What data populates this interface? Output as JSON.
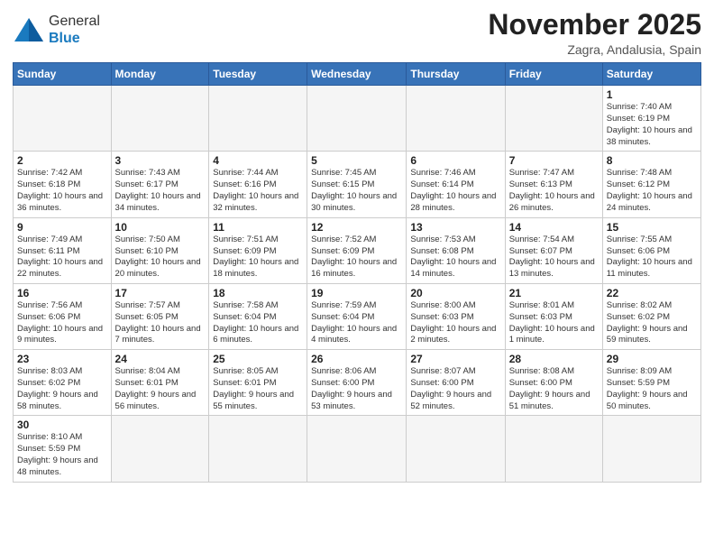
{
  "logo": {
    "text_general": "General",
    "text_blue": "Blue"
  },
  "title": "November 2025",
  "location": "Zagra, Andalusia, Spain",
  "weekdays": [
    "Sunday",
    "Monday",
    "Tuesday",
    "Wednesday",
    "Thursday",
    "Friday",
    "Saturday"
  ],
  "weeks": [
    [
      {
        "day": "",
        "info": ""
      },
      {
        "day": "",
        "info": ""
      },
      {
        "day": "",
        "info": ""
      },
      {
        "day": "",
        "info": ""
      },
      {
        "day": "",
        "info": ""
      },
      {
        "day": "",
        "info": ""
      },
      {
        "day": "1",
        "info": "Sunrise: 7:40 AM\nSunset: 6:19 PM\nDaylight: 10 hours and 38 minutes."
      }
    ],
    [
      {
        "day": "2",
        "info": "Sunrise: 7:42 AM\nSunset: 6:18 PM\nDaylight: 10 hours and 36 minutes."
      },
      {
        "day": "3",
        "info": "Sunrise: 7:43 AM\nSunset: 6:17 PM\nDaylight: 10 hours and 34 minutes."
      },
      {
        "day": "4",
        "info": "Sunrise: 7:44 AM\nSunset: 6:16 PM\nDaylight: 10 hours and 32 minutes."
      },
      {
        "day": "5",
        "info": "Sunrise: 7:45 AM\nSunset: 6:15 PM\nDaylight: 10 hours and 30 minutes."
      },
      {
        "day": "6",
        "info": "Sunrise: 7:46 AM\nSunset: 6:14 PM\nDaylight: 10 hours and 28 minutes."
      },
      {
        "day": "7",
        "info": "Sunrise: 7:47 AM\nSunset: 6:13 PM\nDaylight: 10 hours and 26 minutes."
      },
      {
        "day": "8",
        "info": "Sunrise: 7:48 AM\nSunset: 6:12 PM\nDaylight: 10 hours and 24 minutes."
      }
    ],
    [
      {
        "day": "9",
        "info": "Sunrise: 7:49 AM\nSunset: 6:11 PM\nDaylight: 10 hours and 22 minutes."
      },
      {
        "day": "10",
        "info": "Sunrise: 7:50 AM\nSunset: 6:10 PM\nDaylight: 10 hours and 20 minutes."
      },
      {
        "day": "11",
        "info": "Sunrise: 7:51 AM\nSunset: 6:09 PM\nDaylight: 10 hours and 18 minutes."
      },
      {
        "day": "12",
        "info": "Sunrise: 7:52 AM\nSunset: 6:09 PM\nDaylight: 10 hours and 16 minutes."
      },
      {
        "day": "13",
        "info": "Sunrise: 7:53 AM\nSunset: 6:08 PM\nDaylight: 10 hours and 14 minutes."
      },
      {
        "day": "14",
        "info": "Sunrise: 7:54 AM\nSunset: 6:07 PM\nDaylight: 10 hours and 13 minutes."
      },
      {
        "day": "15",
        "info": "Sunrise: 7:55 AM\nSunset: 6:06 PM\nDaylight: 10 hours and 11 minutes."
      }
    ],
    [
      {
        "day": "16",
        "info": "Sunrise: 7:56 AM\nSunset: 6:06 PM\nDaylight: 10 hours and 9 minutes."
      },
      {
        "day": "17",
        "info": "Sunrise: 7:57 AM\nSunset: 6:05 PM\nDaylight: 10 hours and 7 minutes."
      },
      {
        "day": "18",
        "info": "Sunrise: 7:58 AM\nSunset: 6:04 PM\nDaylight: 10 hours and 6 minutes."
      },
      {
        "day": "19",
        "info": "Sunrise: 7:59 AM\nSunset: 6:04 PM\nDaylight: 10 hours and 4 minutes."
      },
      {
        "day": "20",
        "info": "Sunrise: 8:00 AM\nSunset: 6:03 PM\nDaylight: 10 hours and 2 minutes."
      },
      {
        "day": "21",
        "info": "Sunrise: 8:01 AM\nSunset: 6:03 PM\nDaylight: 10 hours and 1 minute."
      },
      {
        "day": "22",
        "info": "Sunrise: 8:02 AM\nSunset: 6:02 PM\nDaylight: 9 hours and 59 minutes."
      }
    ],
    [
      {
        "day": "23",
        "info": "Sunrise: 8:03 AM\nSunset: 6:02 PM\nDaylight: 9 hours and 58 minutes."
      },
      {
        "day": "24",
        "info": "Sunrise: 8:04 AM\nSunset: 6:01 PM\nDaylight: 9 hours and 56 minutes."
      },
      {
        "day": "25",
        "info": "Sunrise: 8:05 AM\nSunset: 6:01 PM\nDaylight: 9 hours and 55 minutes."
      },
      {
        "day": "26",
        "info": "Sunrise: 8:06 AM\nSunset: 6:00 PM\nDaylight: 9 hours and 53 minutes."
      },
      {
        "day": "27",
        "info": "Sunrise: 8:07 AM\nSunset: 6:00 PM\nDaylight: 9 hours and 52 minutes."
      },
      {
        "day": "28",
        "info": "Sunrise: 8:08 AM\nSunset: 6:00 PM\nDaylight: 9 hours and 51 minutes."
      },
      {
        "day": "29",
        "info": "Sunrise: 8:09 AM\nSunset: 5:59 PM\nDaylight: 9 hours and 50 minutes."
      }
    ],
    [
      {
        "day": "30",
        "info": "Sunrise: 8:10 AM\nSunset: 5:59 PM\nDaylight: 9 hours and 48 minutes."
      },
      {
        "day": "",
        "info": ""
      },
      {
        "day": "",
        "info": ""
      },
      {
        "day": "",
        "info": ""
      },
      {
        "day": "",
        "info": ""
      },
      {
        "day": "",
        "info": ""
      },
      {
        "day": "",
        "info": ""
      }
    ]
  ]
}
